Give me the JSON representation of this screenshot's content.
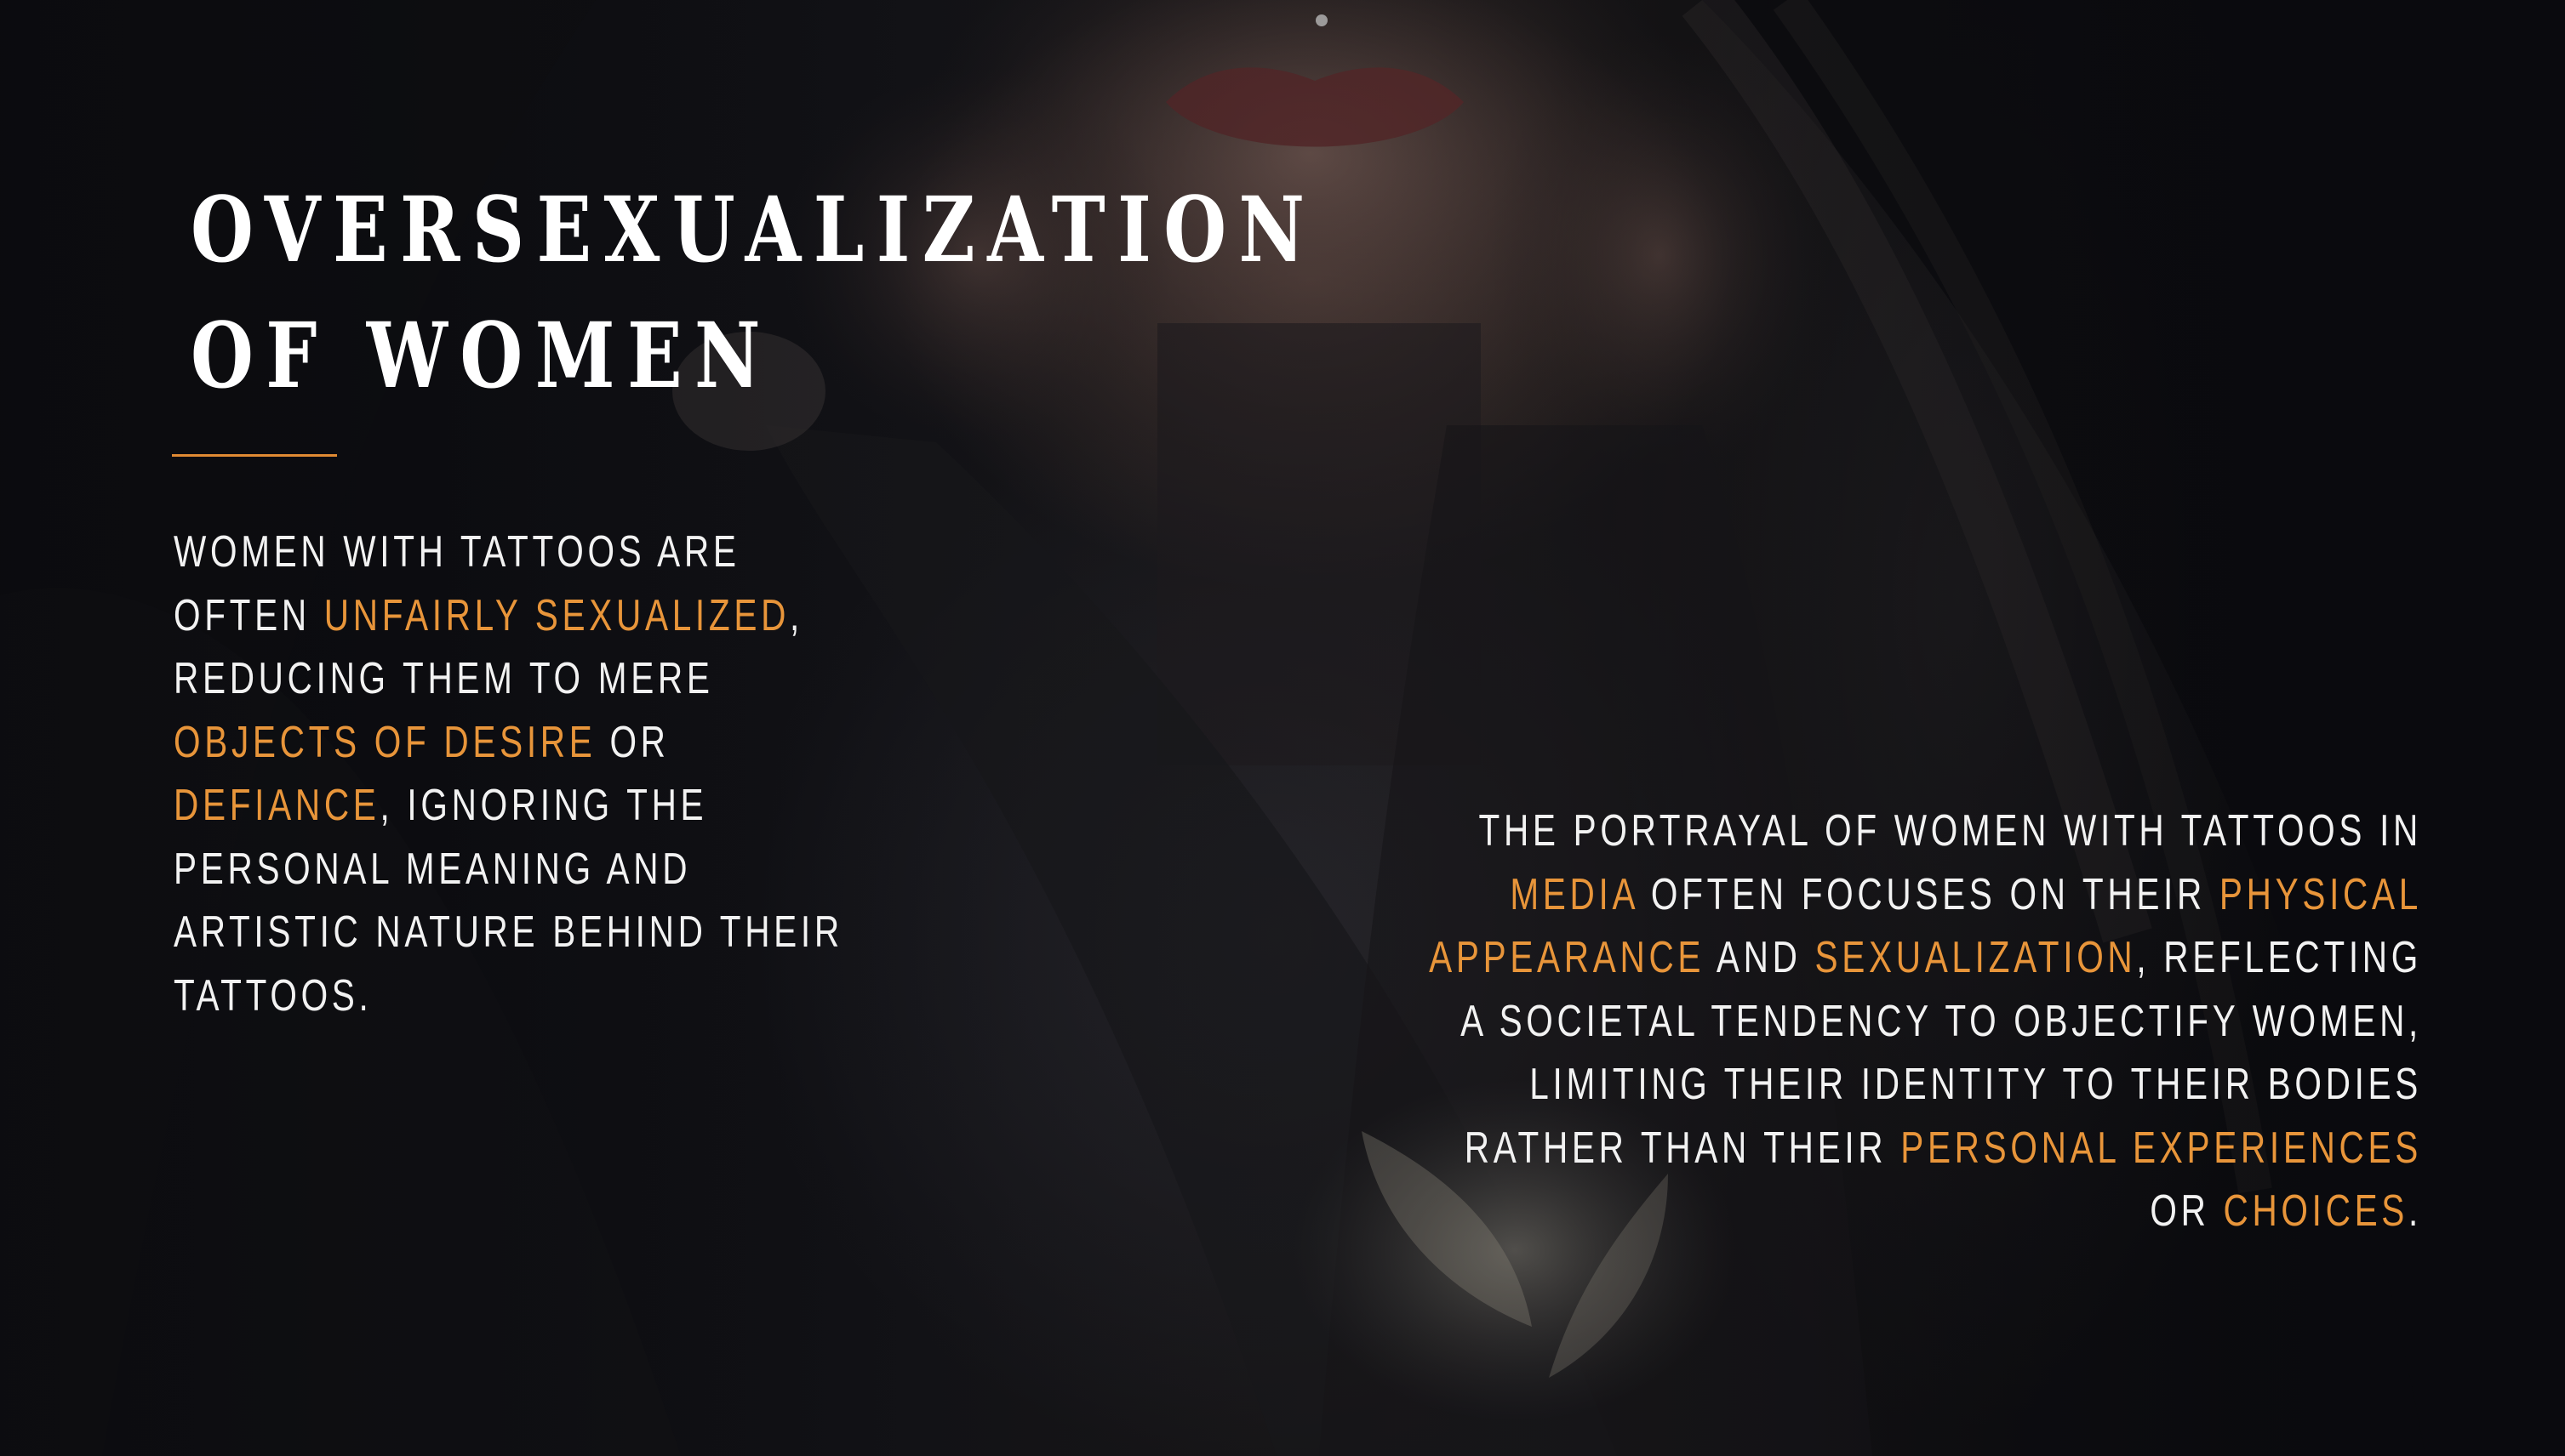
{
  "slide": {
    "title": "Oversexualization of Women",
    "accent_color": "#e8953a",
    "left_paragraph": [
      {
        "text": "Women with tattoos are often ",
        "highlight": false
      },
      {
        "text": "unfairly sexualized",
        "highlight": true
      },
      {
        "text": ", reducing them to mere ",
        "highlight": false
      },
      {
        "text": "objects of desire",
        "highlight": true
      },
      {
        "text": " or ",
        "highlight": false
      },
      {
        "text": "defiance",
        "highlight": true
      },
      {
        "text": ", ignoring the personal meaning and artistic nature behind their tattoos.",
        "highlight": false
      }
    ],
    "right_paragraph": [
      {
        "text": "The portrayal of women with tattoos in ",
        "highlight": false
      },
      {
        "text": "media",
        "highlight": true
      },
      {
        "text": " often focuses on their ",
        "highlight": false
      },
      {
        "text": "physical appearance",
        "highlight": true
      },
      {
        "text": " and ",
        "highlight": false
      },
      {
        "text": "sexualization",
        "highlight": true
      },
      {
        "text": ", reflecting a societal tendency to objectify women, limiting their identity to their bodies rather than their ",
        "highlight": false
      },
      {
        "text": "personal experiences",
        "highlight": true
      },
      {
        "text": " or ",
        "highlight": false
      },
      {
        "text": "choices",
        "highlight": true
      },
      {
        "text": ".",
        "highlight": false
      }
    ]
  }
}
